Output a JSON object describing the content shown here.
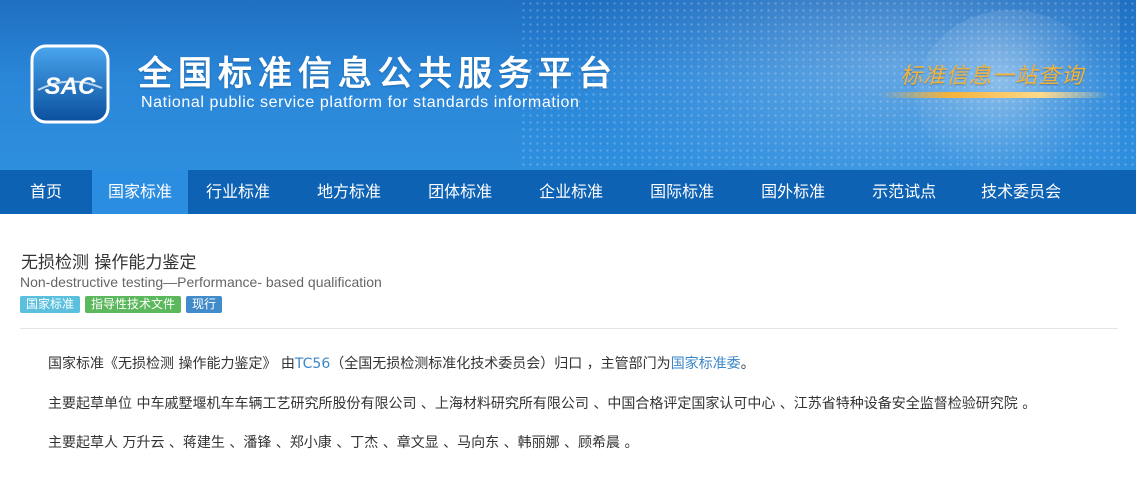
{
  "header": {
    "logo_text": "SAC",
    "title_cn": "全国标准信息公共服务平台",
    "title_en": "National public service platform  for standards information",
    "slogan": "标准信息一站查询"
  },
  "nav": {
    "items": [
      "首页",
      "国家标准",
      "行业标准",
      "地方标准",
      "团体标准",
      "企业标准",
      "国际标准",
      "国外标准",
      "示范试点",
      "技术委员会"
    ],
    "active_index": 1
  },
  "standard": {
    "title": "无损检测 操作能力鉴定",
    "title_en": "Non-destructive testing—Performance- based qualification",
    "tags": [
      "国家标准",
      "指导性技术文件",
      "现行"
    ]
  },
  "details": {
    "p1_prefix": "国家标准《无损检测 操作能力鉴定》 由",
    "committee_link": "TC56",
    "p1_middle": "（全国无损检测标准化技术委员会）归口 ，主管部门为",
    "authority_link": "国家标准委",
    "p1_suffix": "。",
    "p2": "主要起草单位 中车戚墅堰机车车辆工艺研究所股份有限公司 、上海材料研究所有限公司 、中国合格评定国家认可中心 、江苏省特种设备安全监督检验研究院 。",
    "p3": "主要起草人 万升云 、蒋建生 、潘锋 、郑小康 、丁杰 、章文显 、马向东 、韩丽娜 、顾希晨 。"
  },
  "colors": {
    "banner": "#2a86d8",
    "nav": "#0e62b4",
    "nav_active": "#2b8de0",
    "link": "#3a87c8"
  }
}
